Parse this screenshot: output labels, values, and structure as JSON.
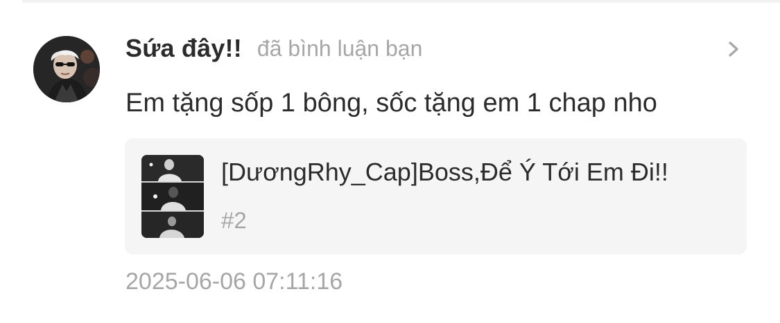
{
  "notification": {
    "username": "Sứa đây!!",
    "action": "đã bình luận bạn",
    "comment": "Em tặng sốp 1 bông, sốc tặng em 1 chap nho",
    "chapter": {
      "title": "[DươngRhy_Cap]Boss,Để Ý Tới Em Đi!!",
      "number": "#2"
    },
    "timestamp": "2025-06-06 07:11:16"
  },
  "icons": {
    "chevron": "chevron-right-icon"
  },
  "colors": {
    "primary_text": "#2b2b2b",
    "secondary_text": "#a6a6a6",
    "card_background": "#f5f5f5"
  }
}
